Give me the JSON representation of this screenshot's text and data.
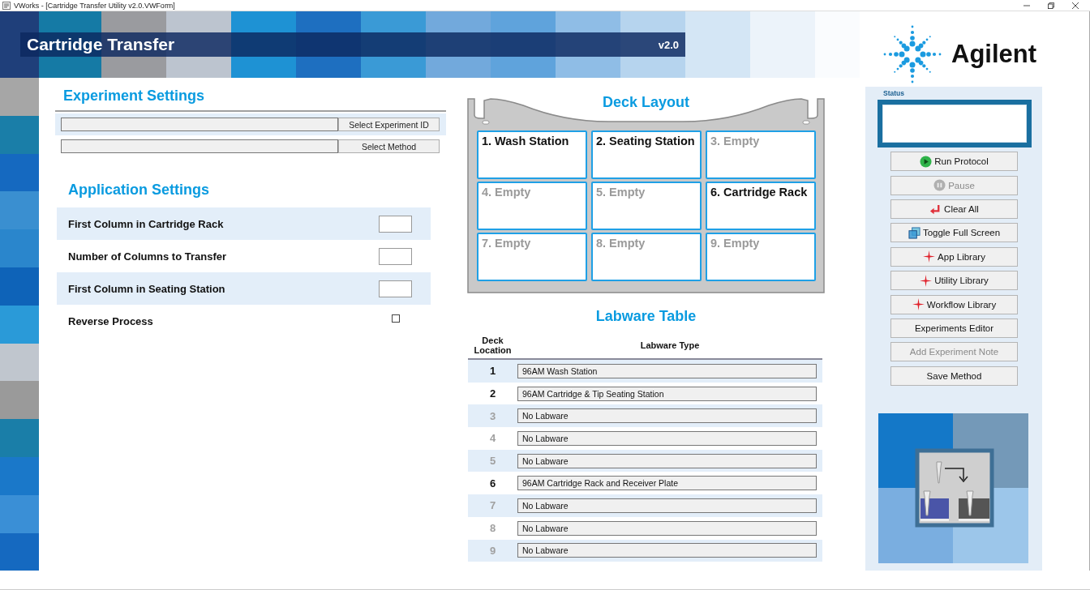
{
  "window": {
    "title": "VWorks - [Cartridge Transfer Utility v2.0.VWForm]"
  },
  "header": {
    "title": "Cartridge Transfer",
    "version": "v2.0"
  },
  "brand": {
    "name": "Agilent"
  },
  "experiment_settings": {
    "heading": "Experiment Settings",
    "rows": [
      {
        "button": "Select Experiment ID"
      },
      {
        "button": "Select Method"
      }
    ]
  },
  "application_settings": {
    "heading": "Application Settings",
    "rows": [
      {
        "kind": "number",
        "label": "First Column in Cartridge Rack"
      },
      {
        "kind": "number",
        "label": "Number of Columns to Transfer"
      },
      {
        "kind": "number",
        "label": "First Column in Seating Station"
      },
      {
        "kind": "checkbox",
        "label": "Reverse Process",
        "checked": false
      }
    ]
  },
  "deck_layout": {
    "heading": "Deck Layout",
    "positions": [
      {
        "label": "1. Wash Station",
        "empty": false
      },
      {
        "label": "2. Seating Station",
        "empty": false
      },
      {
        "label": "3. Empty",
        "empty": true
      },
      {
        "label": "4. Empty",
        "empty": true
      },
      {
        "label": "5. Empty",
        "empty": true
      },
      {
        "label": "6. Cartridge Rack",
        "empty": false
      },
      {
        "label": "7. Empty",
        "empty": true
      },
      {
        "label": "8. Empty",
        "empty": true
      },
      {
        "label": "9. Empty",
        "empty": true
      }
    ]
  },
  "labware_table": {
    "heading": "Labware Table",
    "columns": [
      "Deck Location",
      "Labware Type"
    ],
    "rows": [
      {
        "location": "1",
        "labware": "96AM Wash Station",
        "empty": false
      },
      {
        "location": "2",
        "labware": "96AM Cartridge & Tip Seating Station",
        "empty": false
      },
      {
        "location": "3",
        "labware": "No Labware",
        "empty": true
      },
      {
        "location": "4",
        "labware": "No Labware",
        "empty": true
      },
      {
        "location": "5",
        "labware": "No Labware",
        "empty": true
      },
      {
        "location": "6",
        "labware": "96AM Cartridge Rack and Receiver Plate",
        "empty": false
      },
      {
        "location": "7",
        "labware": "No Labware",
        "empty": true
      },
      {
        "location": "8",
        "labware": "No Labware",
        "empty": true
      },
      {
        "location": "9",
        "labware": "No Labware",
        "empty": true
      }
    ]
  },
  "status": {
    "label": "Status"
  },
  "buttons": [
    {
      "kind": "play",
      "label": "Run Protocol",
      "disabled": false
    },
    {
      "kind": "pause",
      "label": "Pause",
      "disabled": true
    },
    {
      "kind": "clear",
      "label": "Clear All",
      "disabled": false
    },
    {
      "kind": "fullscreen",
      "label": "Toggle Full Screen",
      "disabled": false
    },
    {
      "kind": "library",
      "label": "App Library",
      "disabled": false
    },
    {
      "kind": "library",
      "label": "Utility Library",
      "disabled": false
    },
    {
      "kind": "library",
      "label": "Workflow Library",
      "disabled": false
    },
    {
      "kind": "plain",
      "label": "Experiments Editor",
      "disabled": false
    },
    {
      "kind": "plain",
      "label": "Add Experiment Note",
      "disabled": true
    },
    {
      "kind": "plain",
      "label": "Save Method",
      "disabled": false
    }
  ]
}
